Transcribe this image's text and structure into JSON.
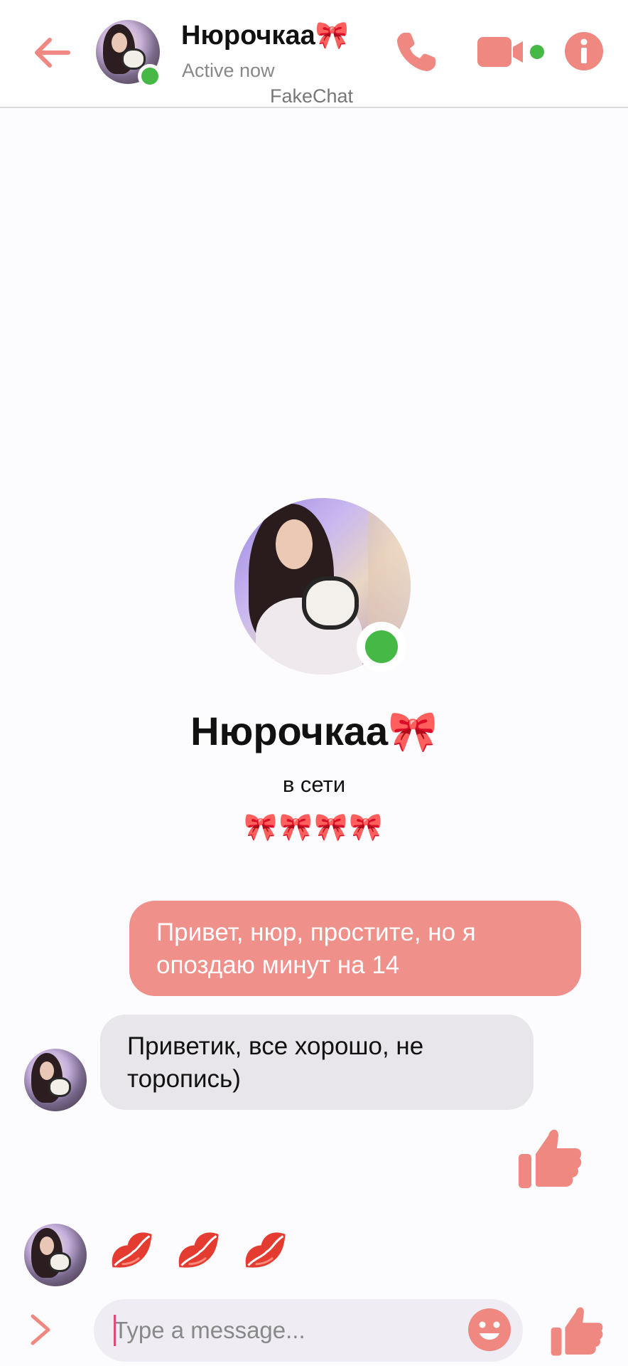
{
  "header": {
    "contact_name": "Нюрочкаа🎀",
    "status": "Active now",
    "watermark": "FakeChat",
    "icons": [
      "back-arrow-icon",
      "phone-icon",
      "video-camera-icon",
      "info-icon"
    ]
  },
  "profile": {
    "name": "Нюрочкаа🎀",
    "subtitle": "в сети",
    "decoration": "🎀🎀🎀🎀"
  },
  "messages": [
    {
      "direction": "outgoing",
      "text": "Привет, нюр, простите, но я опоздаю минут на 14"
    },
    {
      "direction": "incoming",
      "text": "Приветик, все хорошо, не торопись)"
    },
    {
      "direction": "outgoing",
      "type": "like",
      "icon": "thumbs-up-icon"
    },
    {
      "direction": "incoming",
      "type": "emoji",
      "icons": [
        "lips-icon",
        "lips-icon",
        "lips-icon"
      ]
    }
  ],
  "composer": {
    "placeholder": "Type a message...",
    "value": ""
  },
  "colors": {
    "accent": "#ee8880",
    "outgoing_bubble": "#ef908a",
    "incoming_bubble": "#e8e6ea",
    "online": "#45b845"
  }
}
